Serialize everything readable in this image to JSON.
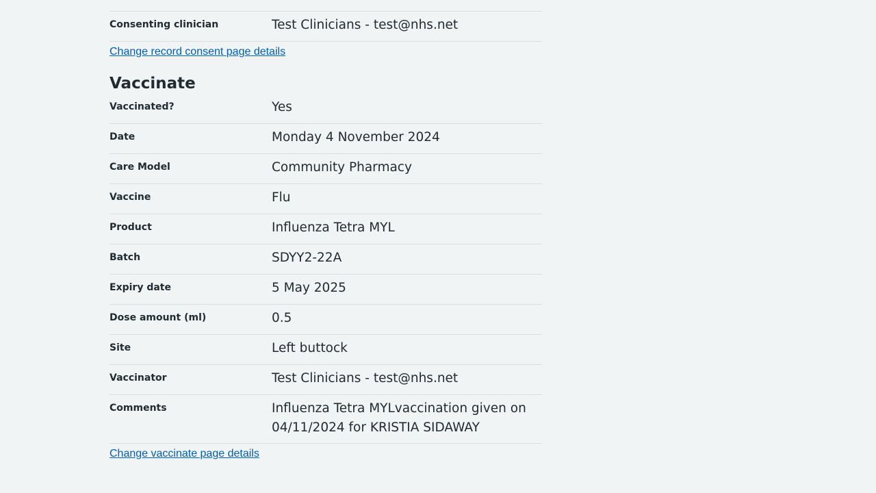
{
  "consent": {
    "rows": [
      {
        "key": "Consenting clinician",
        "value": "Test Clinicians - test@nhs.net"
      }
    ],
    "change_link": "Change record consent page details"
  },
  "vaccinate": {
    "heading": "Vaccinate",
    "rows": [
      {
        "key": "Vaccinated?",
        "value": "Yes"
      },
      {
        "key": "Date",
        "value": "Monday 4 November 2024"
      },
      {
        "key": "Care Model",
        "value": "Community Pharmacy"
      },
      {
        "key": "Vaccine",
        "value": "Flu"
      },
      {
        "key": "Product",
        "value": "Influenza Tetra MYL"
      },
      {
        "key": "Batch",
        "value": "SDYY2-22A"
      },
      {
        "key": "Expiry date",
        "value": "5 May 2025"
      },
      {
        "key": "Dose amount (ml)",
        "value": "0.5"
      },
      {
        "key": "Site",
        "value": "Left buttock"
      },
      {
        "key": "Vaccinator",
        "value": "Test Clinicians - test@nhs.net"
      },
      {
        "key": "Comments",
        "value": "Influenza Tetra MYLvaccination given on 04/11/2024 for KRISTIA SIDAWAY"
      }
    ],
    "change_link": "Change vaccinate page details"
  }
}
